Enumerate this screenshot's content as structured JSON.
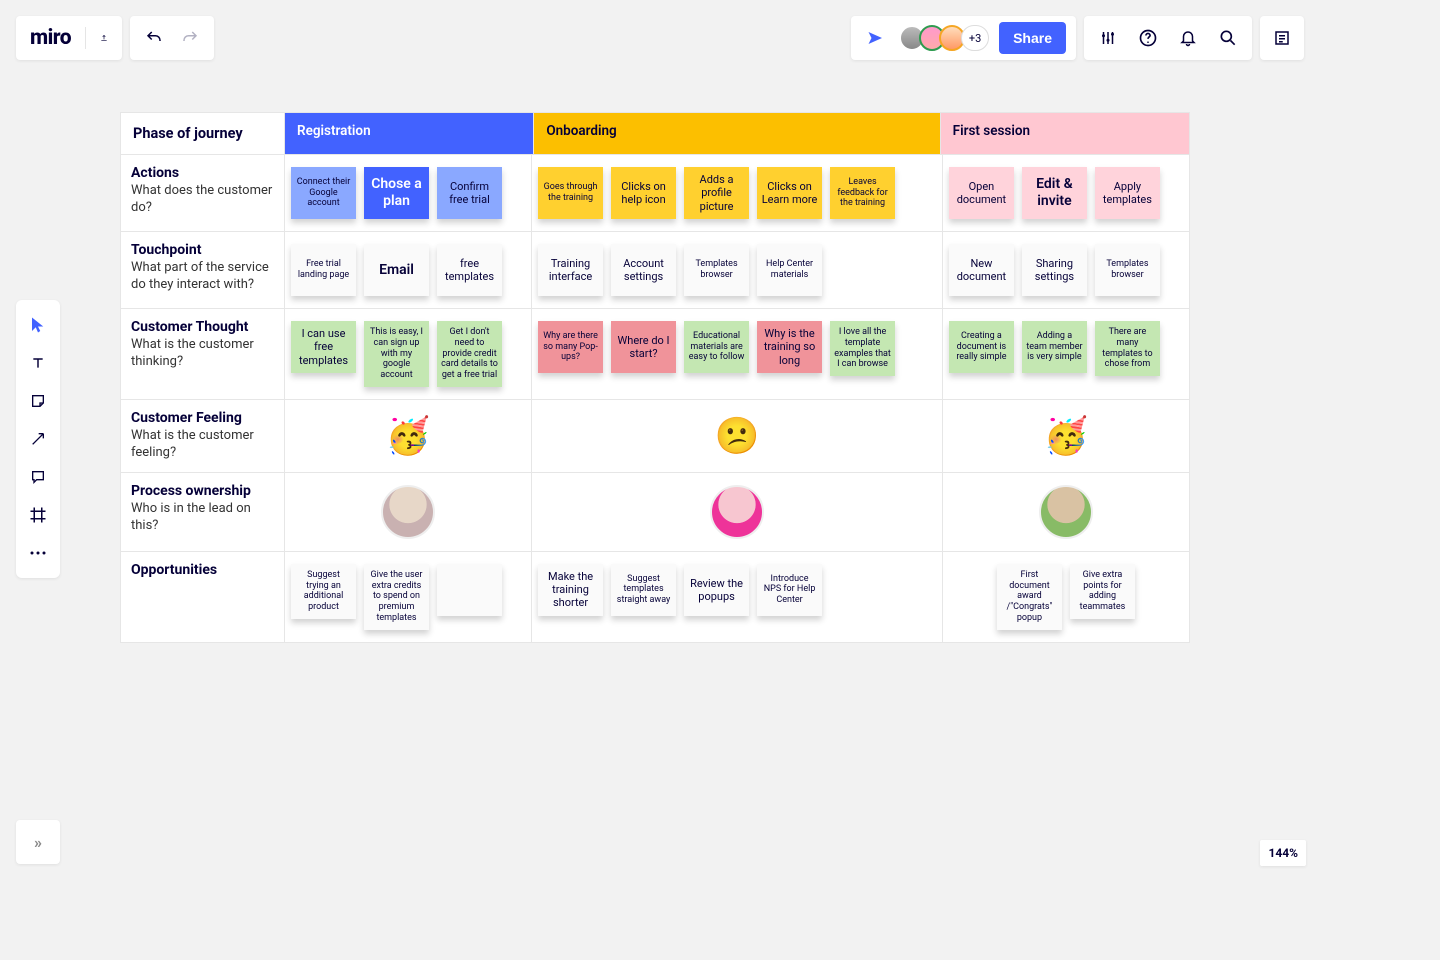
{
  "app": {
    "logo": "miro"
  },
  "presence": {
    "more": "+3",
    "share_label": "Share"
  },
  "zoom": "144%",
  "sidebar_reveal": "»",
  "journey": {
    "header": {
      "label": "Phase of journey"
    },
    "phases": {
      "reg": "Registration",
      "onb": "Onboarding",
      "fst": "First session"
    },
    "rows": {
      "actions": {
        "title": "Actions",
        "sub": "What does the customer do?"
      },
      "touch": {
        "title": "Touchpoint",
        "sub": "What part of the service do they interact with?"
      },
      "thought": {
        "title": "Customer Thought",
        "sub": "What is the customer thinking?"
      },
      "feeling": {
        "title": "Customer Feeling",
        "sub": "What is the customer feeling?"
      },
      "owner": {
        "title": "Process ownership",
        "sub": "Who is in the lead on this?"
      },
      "opps": {
        "title": "Opportunities",
        "sub": ""
      }
    },
    "actions": {
      "reg": [
        "Connect their Google account",
        "Chose a plan",
        "Confirm free trial"
      ],
      "onb": [
        "Goes through the training",
        "Clicks on help icon",
        "Adds a profile picture",
        "Clicks on Learn more",
        "Leaves feedback for the training"
      ],
      "fst": [
        "Open document",
        "Edit & invite",
        "Apply templates"
      ]
    },
    "touch": {
      "reg": [
        "Free trial landing page",
        "Email",
        "free templates"
      ],
      "onb": [
        "Training interface",
        "Account settings",
        "Templates browser",
        "Help Center materials"
      ],
      "fst": [
        "New document",
        "Sharing settings",
        "Templates browser"
      ]
    },
    "thought": {
      "reg": [
        "I can use free templates",
        "This is easy, I can sign up with my google account",
        "Get I don't need to provide credit card details to get a free trial"
      ],
      "onb": [
        "Why are there so many Pop-ups?",
        "Where do I start?",
        "Educational materials are easy to follow",
        "Why is the training so long",
        "I love all the template examples that I can browse"
      ],
      "fst": [
        "Creating a document is really simple",
        "Adding a team member is very simple",
        "There are many templates to chose from"
      ]
    },
    "feeling": {
      "reg": "🥳",
      "onb": "😕",
      "fst": "🥳"
    },
    "opps": {
      "reg": [
        "Suggest trying an additional product",
        "Give the user extra credits to spend on premium templates",
        ""
      ],
      "onb": [
        "Make the training shorter",
        "Suggest templates straight away",
        "Review the popups",
        "Introduce NPS for Help Center"
      ],
      "fst": [
        "First document award /\"Congrats\" popup",
        "Give extra points for adding teammates"
      ]
    }
  }
}
